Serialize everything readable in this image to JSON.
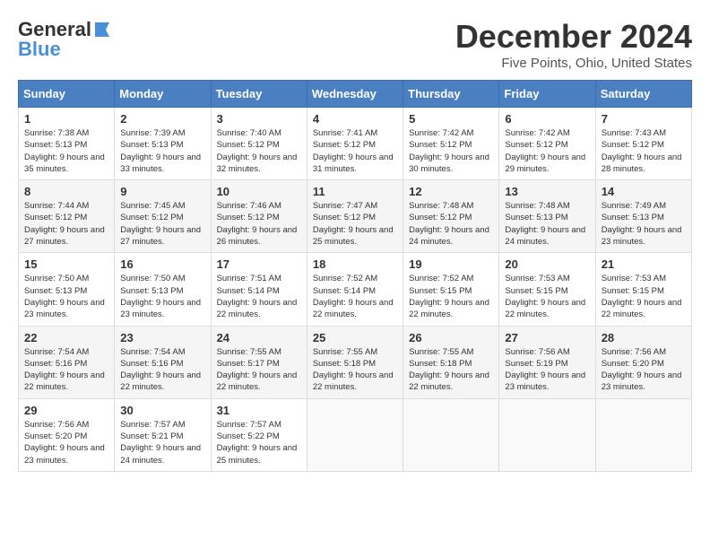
{
  "header": {
    "logo_general": "General",
    "logo_blue": "Blue",
    "month_title": "December 2024",
    "location": "Five Points, Ohio, United States"
  },
  "weekdays": [
    "Sunday",
    "Monday",
    "Tuesday",
    "Wednesday",
    "Thursday",
    "Friday",
    "Saturday"
  ],
  "weeks": [
    [
      {
        "day": "1",
        "sunrise": "7:38 AM",
        "sunset": "5:13 PM",
        "daylight": "9 hours and 35 minutes."
      },
      {
        "day": "2",
        "sunrise": "7:39 AM",
        "sunset": "5:13 PM",
        "daylight": "9 hours and 33 minutes."
      },
      {
        "day": "3",
        "sunrise": "7:40 AM",
        "sunset": "5:12 PM",
        "daylight": "9 hours and 32 minutes."
      },
      {
        "day": "4",
        "sunrise": "7:41 AM",
        "sunset": "5:12 PM",
        "daylight": "9 hours and 31 minutes."
      },
      {
        "day": "5",
        "sunrise": "7:42 AM",
        "sunset": "5:12 PM",
        "daylight": "9 hours and 30 minutes."
      },
      {
        "day": "6",
        "sunrise": "7:42 AM",
        "sunset": "5:12 PM",
        "daylight": "9 hours and 29 minutes."
      },
      {
        "day": "7",
        "sunrise": "7:43 AM",
        "sunset": "5:12 PM",
        "daylight": "9 hours and 28 minutes."
      }
    ],
    [
      {
        "day": "8",
        "sunrise": "7:44 AM",
        "sunset": "5:12 PM",
        "daylight": "9 hours and 27 minutes."
      },
      {
        "day": "9",
        "sunrise": "7:45 AM",
        "sunset": "5:12 PM",
        "daylight": "9 hours and 27 minutes."
      },
      {
        "day": "10",
        "sunrise": "7:46 AM",
        "sunset": "5:12 PM",
        "daylight": "9 hours and 26 minutes."
      },
      {
        "day": "11",
        "sunrise": "7:47 AM",
        "sunset": "5:12 PM",
        "daylight": "9 hours and 25 minutes."
      },
      {
        "day": "12",
        "sunrise": "7:48 AM",
        "sunset": "5:12 PM",
        "daylight": "9 hours and 24 minutes."
      },
      {
        "day": "13",
        "sunrise": "7:48 AM",
        "sunset": "5:13 PM",
        "daylight": "9 hours and 24 minutes."
      },
      {
        "day": "14",
        "sunrise": "7:49 AM",
        "sunset": "5:13 PM",
        "daylight": "9 hours and 23 minutes."
      }
    ],
    [
      {
        "day": "15",
        "sunrise": "7:50 AM",
        "sunset": "5:13 PM",
        "daylight": "9 hours and 23 minutes."
      },
      {
        "day": "16",
        "sunrise": "7:50 AM",
        "sunset": "5:13 PM",
        "daylight": "9 hours and 23 minutes."
      },
      {
        "day": "17",
        "sunrise": "7:51 AM",
        "sunset": "5:14 PM",
        "daylight": "9 hours and 22 minutes."
      },
      {
        "day": "18",
        "sunrise": "7:52 AM",
        "sunset": "5:14 PM",
        "daylight": "9 hours and 22 minutes."
      },
      {
        "day": "19",
        "sunrise": "7:52 AM",
        "sunset": "5:15 PM",
        "daylight": "9 hours and 22 minutes."
      },
      {
        "day": "20",
        "sunrise": "7:53 AM",
        "sunset": "5:15 PM",
        "daylight": "9 hours and 22 minutes."
      },
      {
        "day": "21",
        "sunrise": "7:53 AM",
        "sunset": "5:15 PM",
        "daylight": "9 hours and 22 minutes."
      }
    ],
    [
      {
        "day": "22",
        "sunrise": "7:54 AM",
        "sunset": "5:16 PM",
        "daylight": "9 hours and 22 minutes."
      },
      {
        "day": "23",
        "sunrise": "7:54 AM",
        "sunset": "5:16 PM",
        "daylight": "9 hours and 22 minutes."
      },
      {
        "day": "24",
        "sunrise": "7:55 AM",
        "sunset": "5:17 PM",
        "daylight": "9 hours and 22 minutes."
      },
      {
        "day": "25",
        "sunrise": "7:55 AM",
        "sunset": "5:18 PM",
        "daylight": "9 hours and 22 minutes."
      },
      {
        "day": "26",
        "sunrise": "7:55 AM",
        "sunset": "5:18 PM",
        "daylight": "9 hours and 22 minutes."
      },
      {
        "day": "27",
        "sunrise": "7:56 AM",
        "sunset": "5:19 PM",
        "daylight": "9 hours and 23 minutes."
      },
      {
        "day": "28",
        "sunrise": "7:56 AM",
        "sunset": "5:20 PM",
        "daylight": "9 hours and 23 minutes."
      }
    ],
    [
      {
        "day": "29",
        "sunrise": "7:56 AM",
        "sunset": "5:20 PM",
        "daylight": "9 hours and 23 minutes."
      },
      {
        "day": "30",
        "sunrise": "7:57 AM",
        "sunset": "5:21 PM",
        "daylight": "9 hours and 24 minutes."
      },
      {
        "day": "31",
        "sunrise": "7:57 AM",
        "sunset": "5:22 PM",
        "daylight": "9 hours and 25 minutes."
      },
      null,
      null,
      null,
      null
    ]
  ]
}
